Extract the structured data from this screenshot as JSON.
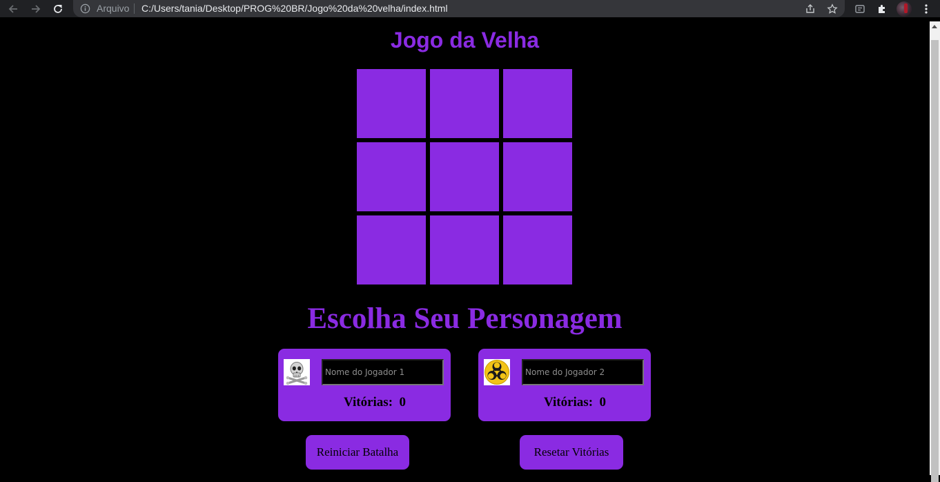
{
  "browser": {
    "origin_label": "Arquivo",
    "url": "C:/Users/tania/Desktop/PROG%20BR/Jogo%20da%20velha/index.html"
  },
  "page": {
    "title": "Jogo da Velha",
    "board": {
      "cells": [
        "",
        "",
        "",
        "",
        "",
        "",
        "",
        "",
        ""
      ]
    },
    "subtitle": "Escolha Seu Personagem",
    "players": [
      {
        "placeholder": "Nome do Jogador 1",
        "wins_label": "Vitórias:",
        "wins": "0",
        "avatar": "skull-crossbones-icon"
      },
      {
        "placeholder": "Nome do Jogador 2",
        "wins_label": "Vitórias:",
        "wins": "0",
        "avatar": "biohazard-icon"
      }
    ],
    "buttons": {
      "restart": "Reiniciar Batalha",
      "reset_wins": "Resetar Vitórias"
    }
  },
  "colors": {
    "accent": "#8a2be2",
    "background": "#000000",
    "chrome": "#202124",
    "omnibox": "#35363a"
  }
}
